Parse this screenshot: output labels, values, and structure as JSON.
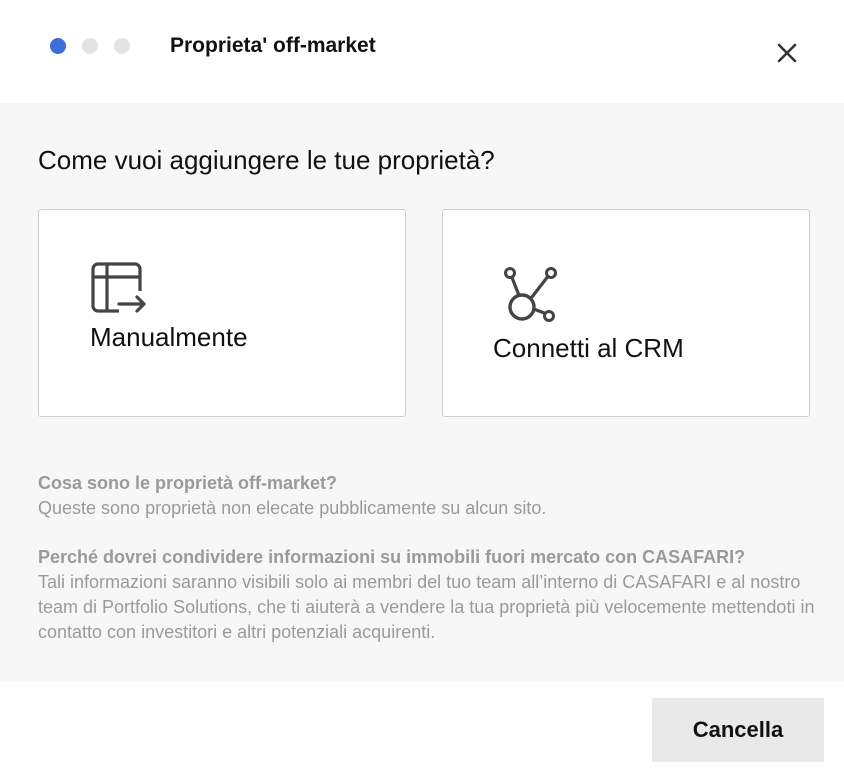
{
  "header": {
    "title": "Proprieta' off-market",
    "steps": [
      {
        "state": "active"
      },
      {
        "state": "inactive"
      },
      {
        "state": "inactive"
      }
    ],
    "close_icon": "close-icon"
  },
  "body": {
    "question": "Come vuoi aggiungere le tue proprietà?",
    "options": [
      {
        "label": "Manualmente",
        "icon": "table-arrow-icon"
      },
      {
        "label": "Connetti al CRM",
        "icon": "crm-connect-icon"
      }
    ],
    "info": [
      {
        "question": "Cosa sono le proprietà off-market?",
        "answer": "Queste sono proprietà non elecate pubblicamente su alcun sito."
      },
      {
        "question": "Perché dovrei condividere informazioni su immobili fuori mercato con CASAFARI?",
        "answer": "Tali informazioni saranno visibili solo ai membri del tuo team all’interno di CASAFARI e al nostro team di Portfolio Solutions, che ti aiuterà a vendere la tua proprietà più velocemente mettendoti in contatto con investitori e altri potenziali acquirenti."
      }
    ]
  },
  "footer": {
    "cancel_label": "Cancella"
  },
  "colors": {
    "accent": "#3c6fd8",
    "step_inactive": "#e3e3e3",
    "body_bg": "#f7f7f7",
    "info_text": "#9a9a9a",
    "button_bg": "#e9e9e9"
  }
}
